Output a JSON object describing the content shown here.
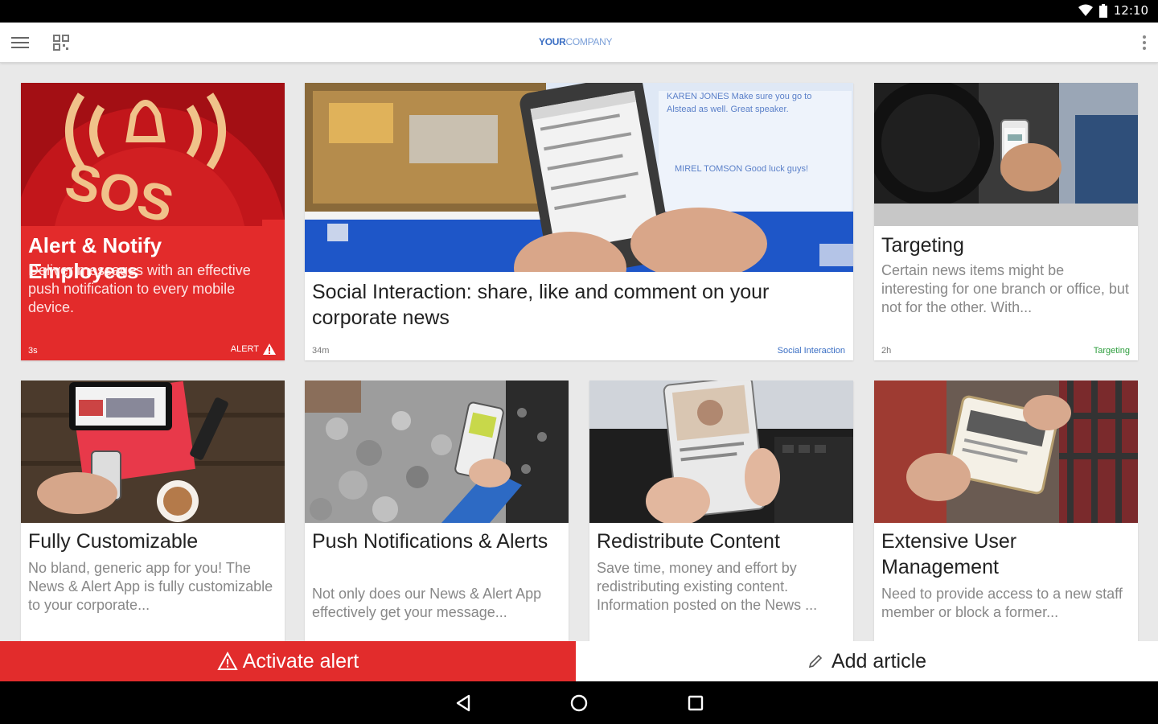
{
  "status_bar": {
    "time": "12:10",
    "icons": [
      "wifi-icon",
      "battery-icon"
    ]
  },
  "app_bar": {
    "logo_bold": "YOUR",
    "logo_rest": "COMPANY"
  },
  "cards": [
    {
      "title": "Alert & Notify Employees",
      "description": "Deliver messages with an effective push notification to every mobile device.",
      "time": "3s",
      "tag": "ALERT"
    },
    {
      "title": "Social Interaction: share, like and comment on your corporate news",
      "description": "",
      "time": "34m",
      "tag": "Social Interaction"
    },
    {
      "title": "Targeting",
      "description": "Certain news items might be interesting for one branch or office, but not for the other. With...",
      "time": "2h",
      "tag": "Targeting"
    },
    {
      "title": "Fully Customizable",
      "description": "No bland, generic app for you! The News & Alert App is fully customizable to your corporate..."
    },
    {
      "title": "Push Notifications & Alerts",
      "description": "Not only does our News & Alert App effectively get your message..."
    },
    {
      "title": "Redistribute Content",
      "description": "Save time, money and effort by redistributing existing content. Information posted on the News ..."
    },
    {
      "title": "Extensive User Management",
      "description": "Need to provide access to a new staff member or block a former..."
    }
  ],
  "actions": {
    "activate_alert": "Activate alert",
    "add_article": "Add article"
  },
  "colors": {
    "alert_red": "#e22c2c",
    "tag_blue": "#3b6fc4",
    "tag_green": "#2e9e3e"
  }
}
